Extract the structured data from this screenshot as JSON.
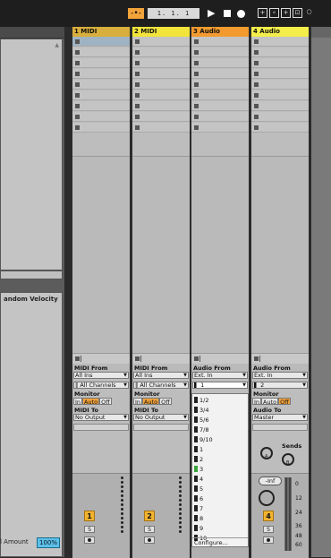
{
  "transport": {
    "metronome_icon": "metronome-icon",
    "position": "1. 1. 1",
    "play_icon": "play-icon",
    "stop_icon": "stop-icon",
    "record_icon": "record-icon",
    "extra_icons": [
      "plus-icon",
      "automation-arm-icon",
      "capture-icon",
      "loop-icon",
      "punch-icon"
    ]
  },
  "browser": {
    "column_headers": "andom  Velocity",
    "amount_label": "l Amount",
    "amount_value": "100%"
  },
  "tracks": [
    {
      "title": "1 MIDI",
      "color": "#d8ae3c",
      "input_label": "MIDI From",
      "input_type": "All Ins",
      "input_channel": "All Channels",
      "monitor_label": "Monitor",
      "monitor": [
        "In",
        "Auto",
        "Off"
      ],
      "monitor_active": 1,
      "output_label": "MIDI To",
      "output": "No Output",
      "number": "1",
      "solo": "S"
    },
    {
      "title": "2 MIDI",
      "color": "#f2e43a",
      "input_label": "MIDI From",
      "input_type": "All Ins",
      "input_channel": "All Channels",
      "monitor_label": "Monitor",
      "monitor": [
        "In",
        "Auto",
        "Off"
      ],
      "monitor_active": 1,
      "output_label": "MIDI To",
      "output": "No Output",
      "number": "2",
      "solo": "S"
    },
    {
      "title": "3 Audio",
      "color": "#f29a2e",
      "input_label": "Audio From",
      "input_type": "Ext. In",
      "input_channel": "1"
    },
    {
      "title": "4 Audio",
      "color": "#f4ee4a",
      "input_label": "Audio From",
      "input_type": "Ext. In",
      "input_channel": "2",
      "monitor_label": "Monitor",
      "monitor": [
        "In",
        "Auto",
        "Off"
      ],
      "monitor_active": 2,
      "output_label": "Audio To",
      "output": "Master",
      "sends_label": "Sends",
      "send_a": "A",
      "send_b": "B",
      "volume": "-Inf",
      "number": "4",
      "solo": "S",
      "meter_scale": [
        "0",
        "12",
        "24",
        "36",
        "48",
        "60"
      ]
    }
  ],
  "input_popup": {
    "items": [
      "1/2",
      "3/4",
      "5/6",
      "7/8",
      "9/10",
      "1",
      "2",
      "3",
      "4",
      "5",
      "6",
      "7",
      "8",
      "9",
      "10"
    ],
    "footer": "Configure..."
  }
}
